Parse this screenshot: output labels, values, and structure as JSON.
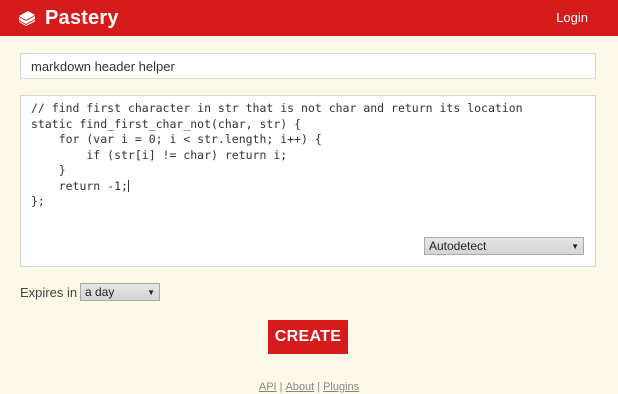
{
  "header": {
    "brand": "Pastery",
    "login": "Login",
    "brand_color": "#d51b1b"
  },
  "paste": {
    "title_value": "markdown header helper",
    "code_lines": [
      "// find first character in str that is not char and return its location",
      "static find_first_char_not(char, str) {",
      "    for (var i = 0; i < str.length; i++) {",
      "        if (str[i] != char) return i;",
      "    }",
      "    return -1;",
      "};"
    ],
    "language": "Autodetect"
  },
  "options": {
    "expires_label": "Expires in",
    "expires_value": "a day"
  },
  "actions": {
    "create_label": "CREATE"
  },
  "footer": {
    "links": [
      "API",
      "About",
      "Plugins"
    ],
    "separator": "|"
  },
  "icons": {
    "brand": "cake-slice-icon",
    "dropdown": "dropdown-arrow-icon"
  }
}
